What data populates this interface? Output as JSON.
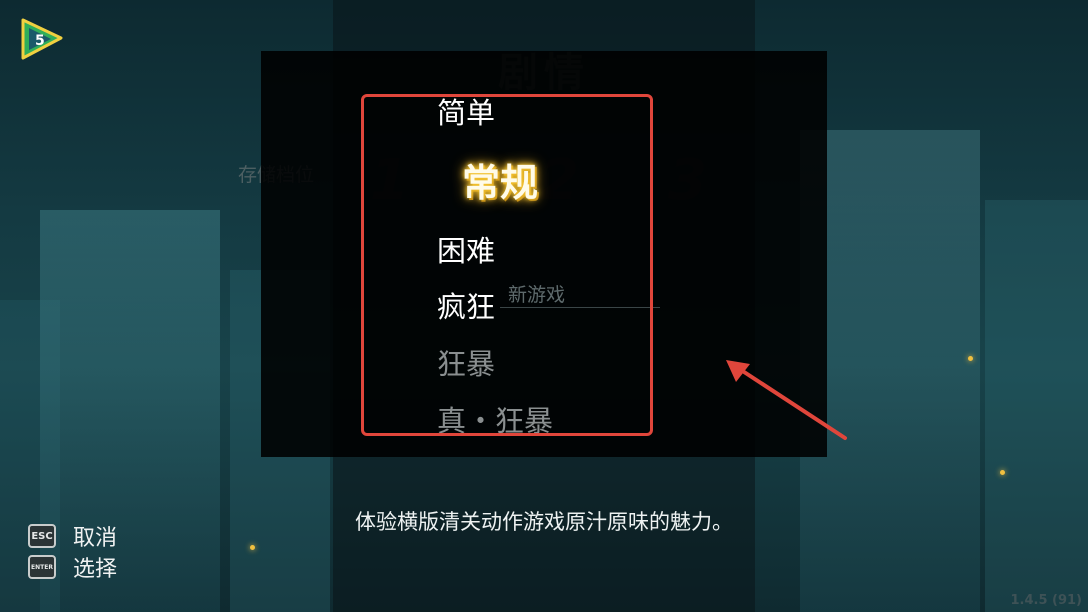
{
  "background": {
    "mode_title": "剧情",
    "save_slot_label": "存储档位",
    "slots": [
      "1",
      "2",
      "3"
    ],
    "new_game_label": "新游戏"
  },
  "logo": {
    "text": "5",
    "icon": "logo-badge-icon"
  },
  "difficulty_menu": {
    "options": [
      {
        "label": "简单",
        "state": "normal"
      },
      {
        "label": "常规",
        "state": "selected"
      },
      {
        "label": "困难",
        "state": "normal"
      },
      {
        "label": "疯狂",
        "state": "normal"
      },
      {
        "label": "狂暴",
        "state": "locked"
      },
      {
        "label": "真・狂暴",
        "state": "locked"
      }
    ],
    "highlight_color": "#e0463b",
    "selected_glow": "#f5c531"
  },
  "description": "体验横版清关动作游戏原汁原味的魅力。",
  "controls": [
    {
      "key": "ESC",
      "label": "取消"
    },
    {
      "key": "ENTER",
      "label": "选择"
    }
  ],
  "version": "1.4.5 (91)"
}
